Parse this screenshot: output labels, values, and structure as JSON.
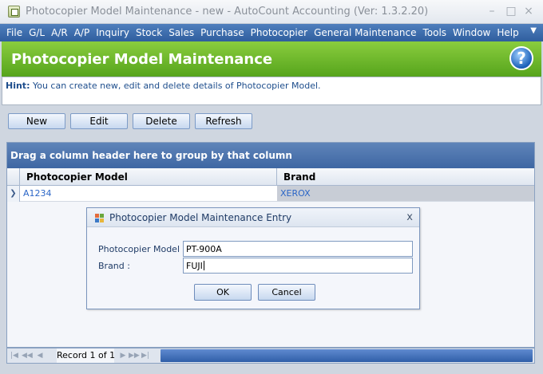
{
  "window": {
    "title": "Photocopier Model Maintenance - new - AutoCount Accounting (Ver: 1.3.2.20)",
    "minimize": "–",
    "maximize": "□",
    "close": "×"
  },
  "menu": [
    {
      "label": "File"
    },
    {
      "label": "G/L"
    },
    {
      "label": "A/R"
    },
    {
      "label": "A/P"
    },
    {
      "label": "Inquiry"
    },
    {
      "label": "Stock"
    },
    {
      "label": "Sales"
    },
    {
      "label": "Purchase"
    },
    {
      "label": "Photocopier"
    },
    {
      "label": "General Maintenance"
    },
    {
      "label": "Tools"
    },
    {
      "label": "Window"
    },
    {
      "label": "Help"
    }
  ],
  "header": {
    "title": "Photocopier Model Maintenance",
    "help_glyph": "?"
  },
  "hint": {
    "label": "Hint:",
    "text": "You can create new, edit and delete details of Photocopier Model."
  },
  "toolbar": {
    "new_label": "New",
    "edit_label": "Edit",
    "delete_label": "Delete",
    "refresh_label": "Refresh"
  },
  "grid": {
    "group_hint": "Drag a column header here to group by that column",
    "columns": [
      "Photocopier Model",
      "Brand"
    ],
    "rows": [
      {
        "model": "A1234",
        "brand": "XEROX"
      }
    ]
  },
  "navigator": {
    "record_text": "Record 1 of 1"
  },
  "dialog": {
    "title": "Photocopier Model Maintenance Entry",
    "close_glyph": "x",
    "model_label": "Photocopier Model :",
    "model_value": "PT-900A",
    "brand_label": "Brand :",
    "brand_value": "FUJI",
    "ok_label": "OK",
    "cancel_label": "Cancel"
  }
}
